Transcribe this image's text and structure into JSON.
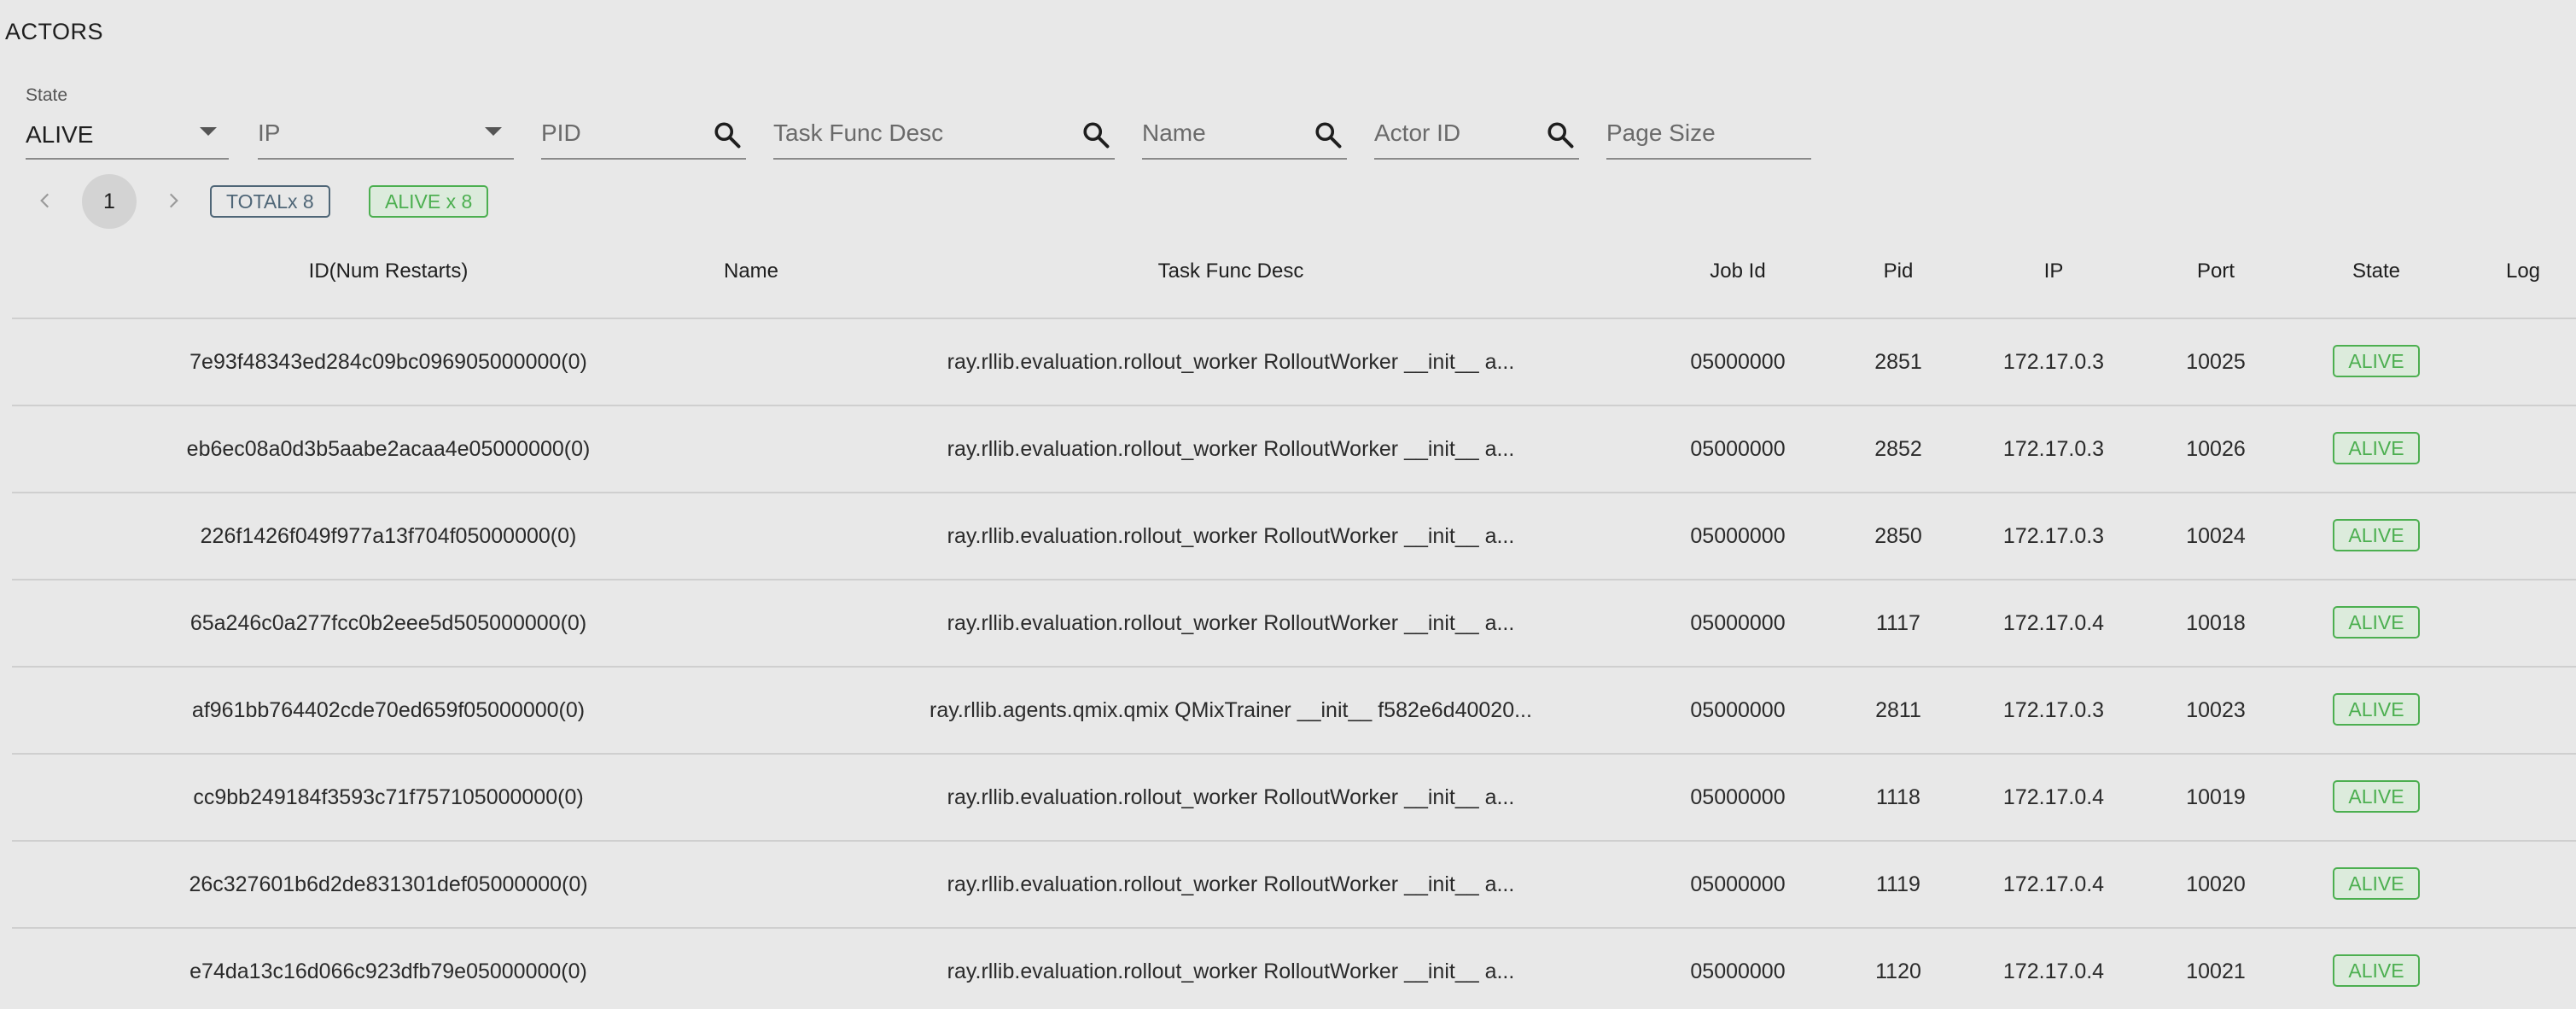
{
  "section_title": "ACTORS",
  "filters": {
    "state": {
      "label": "State",
      "value": "ALIVE"
    },
    "ip": {
      "placeholder": "IP"
    },
    "pid": {
      "placeholder": "PID"
    },
    "task_func_desc": {
      "placeholder": "Task Func Desc"
    },
    "name": {
      "placeholder": "Name"
    },
    "actor_id": {
      "placeholder": "Actor ID"
    },
    "page_size": {
      "placeholder": "Page Size"
    }
  },
  "pagination": {
    "current_page": "1",
    "prev_icon": "chevron-left-icon",
    "next_icon": "chevron-right-icon"
  },
  "chips": {
    "total": "TOTALx 8",
    "alive": "ALIVE x 8"
  },
  "colors": {
    "background": "#e8e8e8",
    "alive_green": "#4caf50",
    "total_slate": "#4f6677"
  },
  "table": {
    "headers": [
      "ID(Num Restarts)",
      "Name",
      "Task Func Desc",
      "Job Id",
      "Pid",
      "IP",
      "Port",
      "State",
      "Log"
    ],
    "rows": [
      {
        "id": "7e93f48343ed284c09bc096905000000(0)",
        "name": "",
        "task": "ray.rllib.evaluation.rollout_worker RolloutWorker __init__ a...",
        "job": "05000000",
        "pid": "2851",
        "ip": "172.17.0.3",
        "port": "10025",
        "state": "ALIVE",
        "log": ""
      },
      {
        "id": "eb6ec08a0d3b5aabe2acaa4e05000000(0)",
        "name": "",
        "task": "ray.rllib.evaluation.rollout_worker RolloutWorker __init__ a...",
        "job": "05000000",
        "pid": "2852",
        "ip": "172.17.0.3",
        "port": "10026",
        "state": "ALIVE",
        "log": ""
      },
      {
        "id": "226f1426f049f977a13f704f05000000(0)",
        "name": "",
        "task": "ray.rllib.evaluation.rollout_worker RolloutWorker __init__ a...",
        "job": "05000000",
        "pid": "2850",
        "ip": "172.17.0.3",
        "port": "10024",
        "state": "ALIVE",
        "log": ""
      },
      {
        "id": "65a246c0a277fcc0b2eee5d505000000(0)",
        "name": "",
        "task": "ray.rllib.evaluation.rollout_worker RolloutWorker __init__ a...",
        "job": "05000000",
        "pid": "1117",
        "ip": "172.17.0.4",
        "port": "10018",
        "state": "ALIVE",
        "log": ""
      },
      {
        "id": "af961bb764402cde70ed659f05000000(0)",
        "name": "",
        "task": "ray.rllib.agents.qmix.qmix QMixTrainer __init__ f582e6d40020...",
        "job": "05000000",
        "pid": "2811",
        "ip": "172.17.0.3",
        "port": "10023",
        "state": "ALIVE",
        "log": ""
      },
      {
        "id": "cc9bb249184f3593c71f757105000000(0)",
        "name": "",
        "task": "ray.rllib.evaluation.rollout_worker RolloutWorker __init__ a...",
        "job": "05000000",
        "pid": "1118",
        "ip": "172.17.0.4",
        "port": "10019",
        "state": "ALIVE",
        "log": ""
      },
      {
        "id": "26c327601b6d2de831301def05000000(0)",
        "name": "",
        "task": "ray.rllib.evaluation.rollout_worker RolloutWorker __init__ a...",
        "job": "05000000",
        "pid": "1119",
        "ip": "172.17.0.4",
        "port": "10020",
        "state": "ALIVE",
        "log": ""
      },
      {
        "id": "e74da13c16d066c923dfb79e05000000(0)",
        "name": "",
        "task": "ray.rllib.evaluation.rollout_worker RolloutWorker __init__ a...",
        "job": "05000000",
        "pid": "1120",
        "ip": "172.17.0.4",
        "port": "10021",
        "state": "ALIVE",
        "log": ""
      }
    ]
  }
}
